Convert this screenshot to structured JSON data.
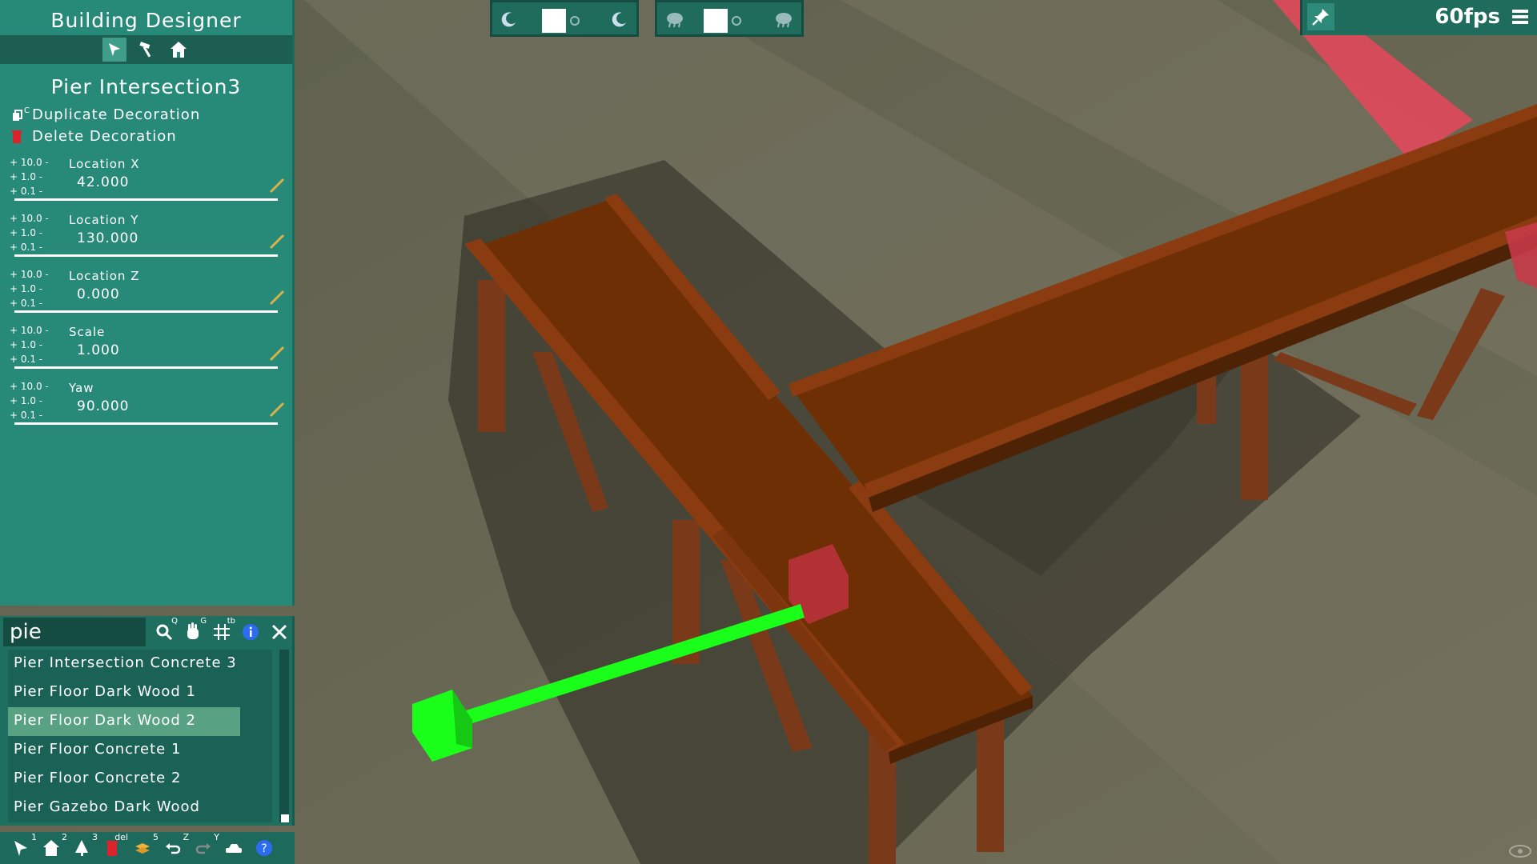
{
  "app": {
    "title": "Building Designer",
    "modes": [
      {
        "icon": "cursor-icon",
        "active": true
      },
      {
        "icon": "hammer-icon",
        "active": false
      },
      {
        "icon": "home-icon",
        "active": false
      }
    ]
  },
  "selection": {
    "title": "Pier Intersection3",
    "duplicate_label": "Duplicate Decoration",
    "duplicate_hotkey": "C",
    "delete_label": "Delete Decoration"
  },
  "steps": [
    "+ 10.0 -",
    "+ 1.0 -",
    "+ 0.1 -"
  ],
  "properties": [
    {
      "label": "Location X",
      "value": "42.000"
    },
    {
      "label": "Location Y",
      "value": "130.000"
    },
    {
      "label": "Location Z",
      "value": "0.000"
    },
    {
      "label": "Scale",
      "value": "1.000"
    },
    {
      "label": "Yaw",
      "value": "90.000"
    }
  ],
  "search": {
    "query": "pie",
    "tools": [
      {
        "icon": "search-icon",
        "hotkey": "Q"
      },
      {
        "icon": "hand-icon",
        "hotkey": "G"
      },
      {
        "icon": "grid-icon",
        "hotkey": "tb"
      },
      {
        "icon": "info-icon",
        "hotkey": ""
      },
      {
        "icon": "close-icon",
        "hotkey": ""
      }
    ],
    "results": [
      "Pier Intersection Concrete 3",
      "Pier Floor Dark Wood 1",
      "Pier Floor Dark Wood 2",
      "Pier Floor Concrete 1",
      "Pier Floor Concrete 2",
      "Pier Gazebo Dark Wood"
    ],
    "selected_index": 2
  },
  "bottom_tools": [
    {
      "icon": "cursor-icon",
      "hotkey": "1"
    },
    {
      "icon": "home-icon",
      "hotkey": "2"
    },
    {
      "icon": "tree-icon",
      "hotkey": "3"
    },
    {
      "icon": "trash-icon",
      "hotkey": "del"
    },
    {
      "icon": "layers-icon",
      "hotkey": "5"
    },
    {
      "icon": "undo-icon",
      "hotkey": "Z"
    },
    {
      "icon": "redo-icon",
      "hotkey": "Y"
    },
    {
      "icon": "car-icon",
      "hotkey": ""
    },
    {
      "icon": "help-icon",
      "hotkey": ""
    }
  ],
  "toggles": [
    {
      "name": "day-night-toggle",
      "left_icon": "moon-icon",
      "right_icon": "moon-icon"
    },
    {
      "name": "weather-toggle",
      "left_icon": "cloud-icon",
      "right_icon": "cloud-icon"
    }
  ],
  "status": {
    "fps": "60fps"
  },
  "colors": {
    "panel": "#278a78",
    "panel_dark": "#1d5e52",
    "selected": "#58a283",
    "wood": "#6e2f05",
    "gizmo": "#1aff1a",
    "highlight_red": "#e8465a"
  }
}
